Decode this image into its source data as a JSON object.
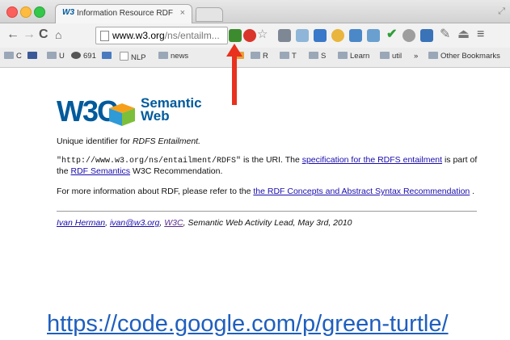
{
  "browser": {
    "tab_title": "Information Resource RDF",
    "tab_icon_text": "W3",
    "tab_close": "×",
    "url_host": "www.w3.org",
    "url_path": "/ns/entailm..."
  },
  "bookmarks": [
    {
      "label": "C",
      "icon": "folder-icon"
    },
    {
      "label": "",
      "icon": "facebook-icon"
    },
    {
      "label": "U",
      "icon": "folder-icon"
    },
    {
      "label": "691",
      "icon": "github-icon"
    },
    {
      "label": "",
      "icon": "share-icon"
    },
    {
      "label": "NLP",
      "icon": "page-icon"
    },
    {
      "label": "news",
      "icon": "folder-icon"
    },
    {
      "label": "",
      "icon": "ext-icon"
    },
    {
      "label": "R",
      "icon": "folder-icon"
    },
    {
      "label": "T",
      "icon": "folder-icon"
    },
    {
      "label": "S",
      "icon": "folder-icon"
    },
    {
      "label": "Learn",
      "icon": "folder-icon"
    },
    {
      "label": "util",
      "icon": "folder-icon"
    },
    {
      "label": "»",
      "icon": ""
    },
    {
      "label": "Other Bookmarks",
      "icon": "folder-icon"
    }
  ],
  "page": {
    "logo_w3c": "W3C",
    "logo_semantic": "Semantic",
    "logo_web": "Web",
    "intro_prefix": "Unique identifier for ",
    "intro_em": "RDFS Entailment.",
    "uri_code": "\"http://www.w3.org/ns/entailment/RDFS\"",
    "uri_text1": " is the URI. The ",
    "uri_link1": "specification for the RDFS entailment",
    "uri_text2": " is part of the ",
    "uri_link2": "RDF Semantics",
    "uri_text3": " W3C Recommendation.",
    "more_text1": "For more information about RDF, please refer to the ",
    "more_link": "the RDF Concepts and Abstract Syntax Recommendation",
    "more_text2": " .",
    "footer_author": "Ivan Herman",
    "footer_sep1": ", ",
    "footer_email": "ivan@w3.org",
    "footer_sep2": ", ",
    "footer_org": "W3C",
    "footer_rest": ", Semantic Web Activity Lead, May 3rd, 2010"
  },
  "caption": "https://code.google.com/p/green-turtle/",
  "colors": {
    "arrow": "#e8311e",
    "w3c_blue": "#005a9c",
    "link": "#1a0dab",
    "caption": "#1f5fbf"
  }
}
